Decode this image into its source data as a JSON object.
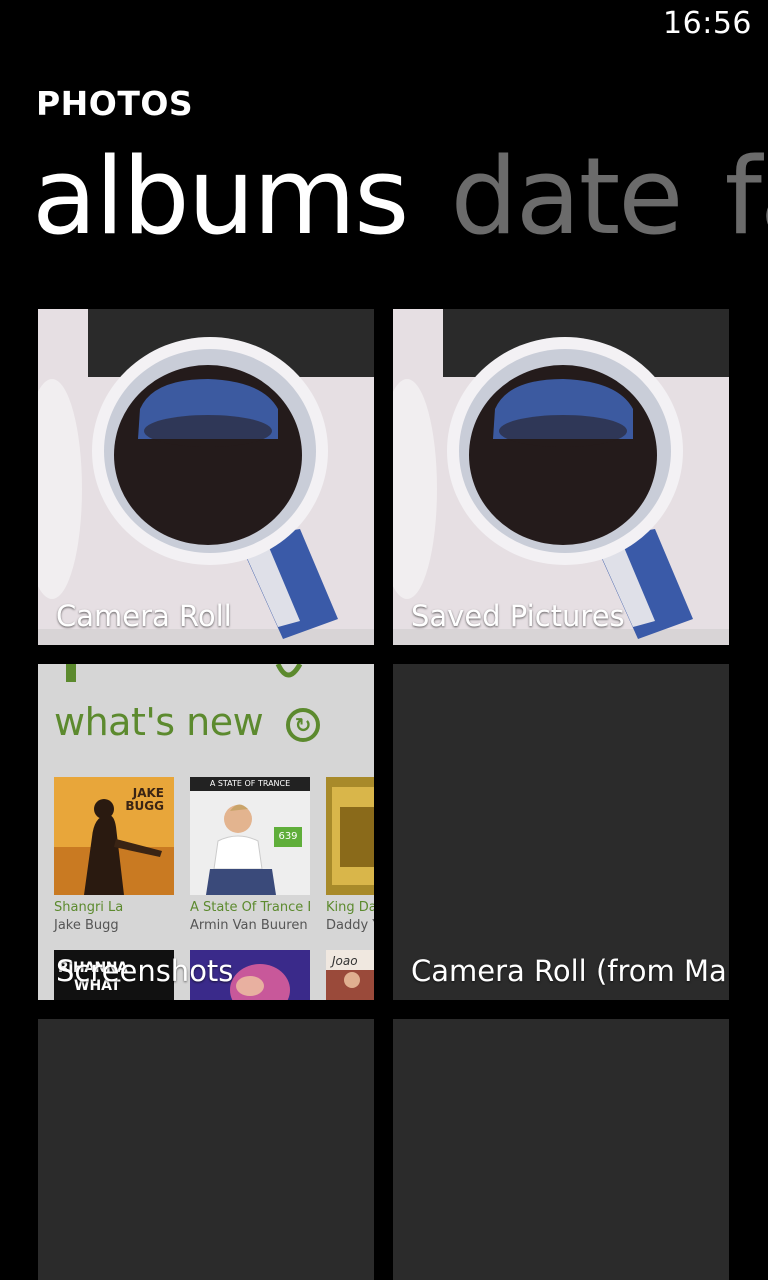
{
  "status": {
    "time": "16:56"
  },
  "app": {
    "title": "PHOTOS"
  },
  "pivot": {
    "items": [
      {
        "label": "albums",
        "active": true
      },
      {
        "label": "date",
        "active": false
      },
      {
        "label": "fa",
        "active": false
      }
    ]
  },
  "albums": [
    {
      "label": "Camera Roll"
    },
    {
      "label": "Saved Pictures"
    },
    {
      "label": "Screenshots"
    },
    {
      "label": "Camera Roll (from Ma"
    },
    {
      "label": ""
    },
    {
      "label": ""
    }
  ],
  "screenshot_thumb": {
    "heading": "what's new",
    "sync_icon": "sync-icon",
    "items": [
      {
        "title": "Shangri La",
        "artist": "Jake Bugg",
        "cover_text": "JAKE BUGG"
      },
      {
        "title": "A State Of Trance Ep",
        "artist": "Armin Van Buuren",
        "cover_text": "A STATE OF TRANCE",
        "badge": "639"
      },
      {
        "title": "King Da",
        "artist": "Daddy Y",
        "cover_text": ""
      }
    ],
    "bottom_texts": [
      "RIHANNA",
      "WHAT",
      "Joao"
    ]
  },
  "colors": {
    "background": "#000000",
    "tile_empty": "#2b2b2b",
    "pivot_inactive": "#6b6b6b",
    "store_green": "#5c8a2e"
  }
}
